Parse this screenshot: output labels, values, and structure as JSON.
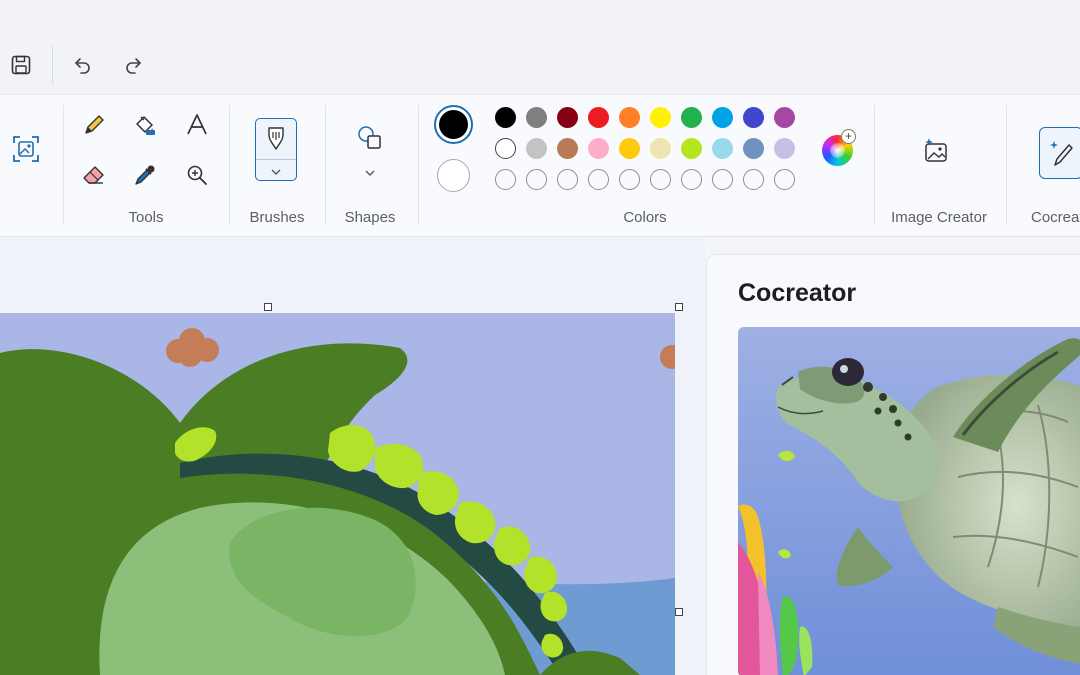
{
  "quick_access": {
    "save_icon": "save-icon",
    "undo_icon": "undo-icon",
    "redo_icon": "redo-icon"
  },
  "ribbon": {
    "groups": {
      "tools": "Tools",
      "brushes": "Brushes",
      "shapes": "Shapes",
      "colors": "Colors",
      "image_creator": "Image Creator",
      "cocreator": "Cocreat"
    },
    "tools": [
      "pencil-icon",
      "fill-bucket-icon",
      "text-icon",
      "eraser-icon",
      "color-picker-icon",
      "magnifier-icon"
    ],
    "colors": {
      "primary": "#000000",
      "secondary": "#ffffff",
      "row1": [
        "#000000",
        "#7f7f7f",
        "#880015",
        "#ed1c24",
        "#ff7f27",
        "#fff200",
        "#22b14c",
        "#00a2e8",
        "#3f48cc",
        "#a349a4"
      ],
      "row2": [
        "#ffffff",
        "#c3c3c3",
        "#b97a57",
        "#ffaec9",
        "#ffc90e",
        "#efe4b0",
        "#b5e61d",
        "#99d9ea",
        "#7092be",
        "#c8bfe7"
      ]
    }
  },
  "cocreator_panel": {
    "title": "Cocreator"
  }
}
